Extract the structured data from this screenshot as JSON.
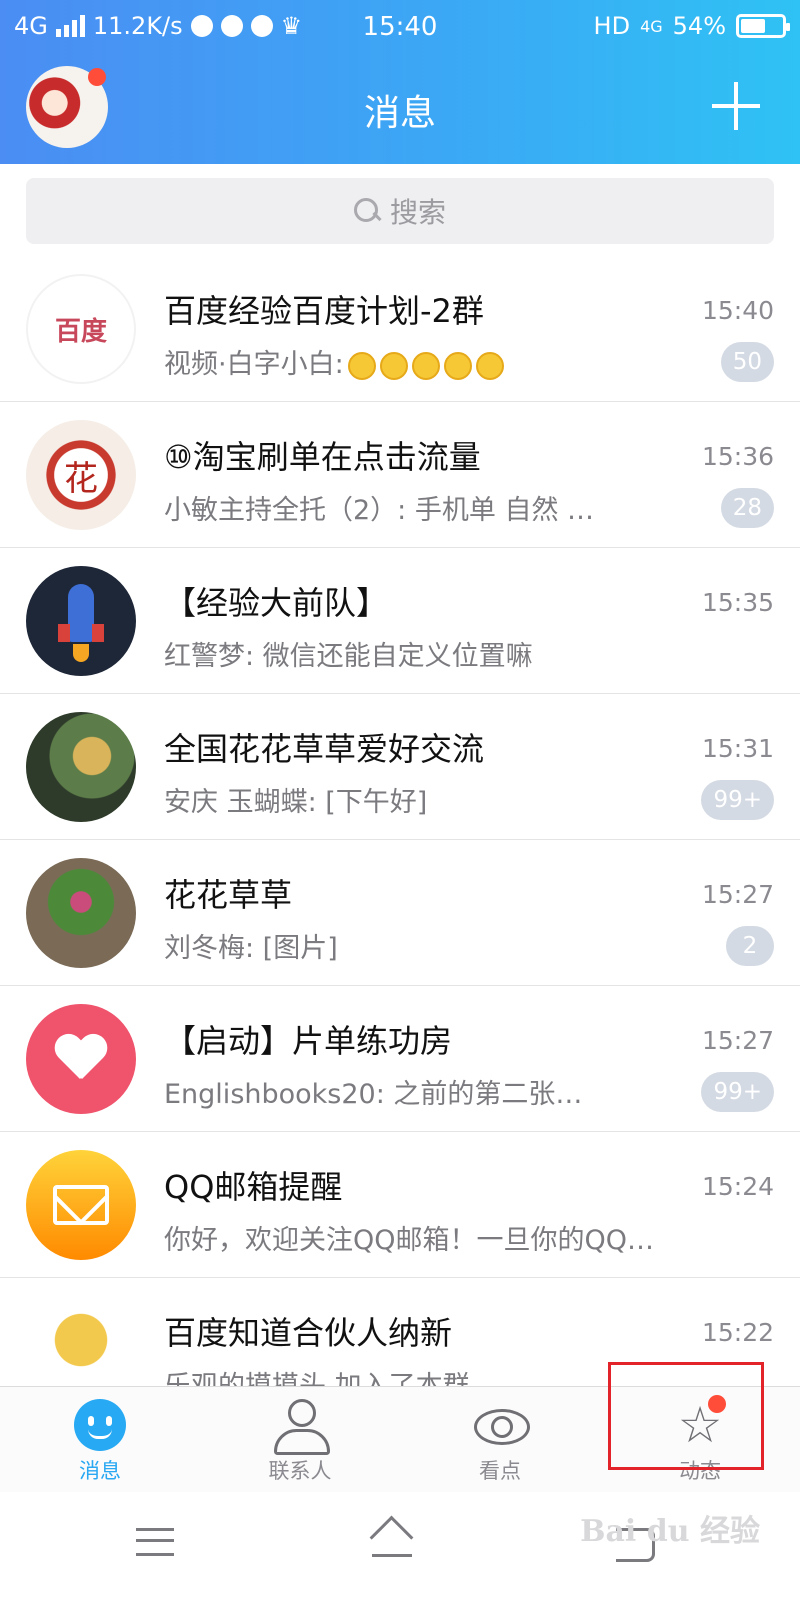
{
  "status_bar": {
    "network": "4G",
    "speed": "11.2K/s",
    "time": "15:40",
    "hd": "HD",
    "net2": "4G",
    "battery": "54%"
  },
  "header": {
    "title": "消息",
    "add_icon": "plus-icon"
  },
  "search": {
    "placeholder": "搜索"
  },
  "conversations": [
    {
      "name": "百度经验百度计划-2群",
      "preview": "视频·白字小白:",
      "time": "15:40",
      "badge": "50",
      "avatar_text": "百度"
    },
    {
      "name": "⑩淘宝刷单在点击流量",
      "preview": "小敏主持全托（2）: 手机单  自然 …",
      "time": "15:36",
      "badge": "28",
      "avatar_text": "花"
    },
    {
      "name": "【经验大前队】",
      "preview": "红警梦: 微信还能自定义位置嘛",
      "time": "15:35",
      "badge": ""
    },
    {
      "name": "全国花花草草爱好交流",
      "preview": "安庆  玉蝴蝶: [下午好]",
      "time": "15:31",
      "badge": "99+"
    },
    {
      "name": "花花草草",
      "preview": "刘冬梅: [图片]",
      "time": "15:27",
      "badge": "2"
    },
    {
      "name": "【启动】片单练功房",
      "preview": "Englishbooks20: 之前的第二张…",
      "time": "15:27",
      "badge": "99+"
    },
    {
      "name": "QQ邮箱提醒",
      "preview": "你好，欢迎关注QQ邮箱！一旦你的QQ…",
      "time": "15:24",
      "badge": ""
    },
    {
      "name": "百度知道合伙人纳新",
      "preview": "乐观的摸摸头 加入了本群",
      "time": "15:22",
      "badge": ""
    }
  ],
  "tabs": [
    {
      "label": "消息",
      "icon": "message-icon",
      "active": true
    },
    {
      "label": "联系人",
      "icon": "contacts-icon",
      "active": false
    },
    {
      "label": "看点",
      "icon": "eye-icon",
      "active": false
    },
    {
      "label": "动态",
      "icon": "star-icon",
      "active": false
    }
  ],
  "watermark": "Bai du 经验",
  "colors": {
    "accent": "#2aa8f2",
    "header_start": "#4b8df3",
    "header_end": "#2fc2f4",
    "badge": "#d4dae3",
    "highlight": "#e3232a"
  }
}
